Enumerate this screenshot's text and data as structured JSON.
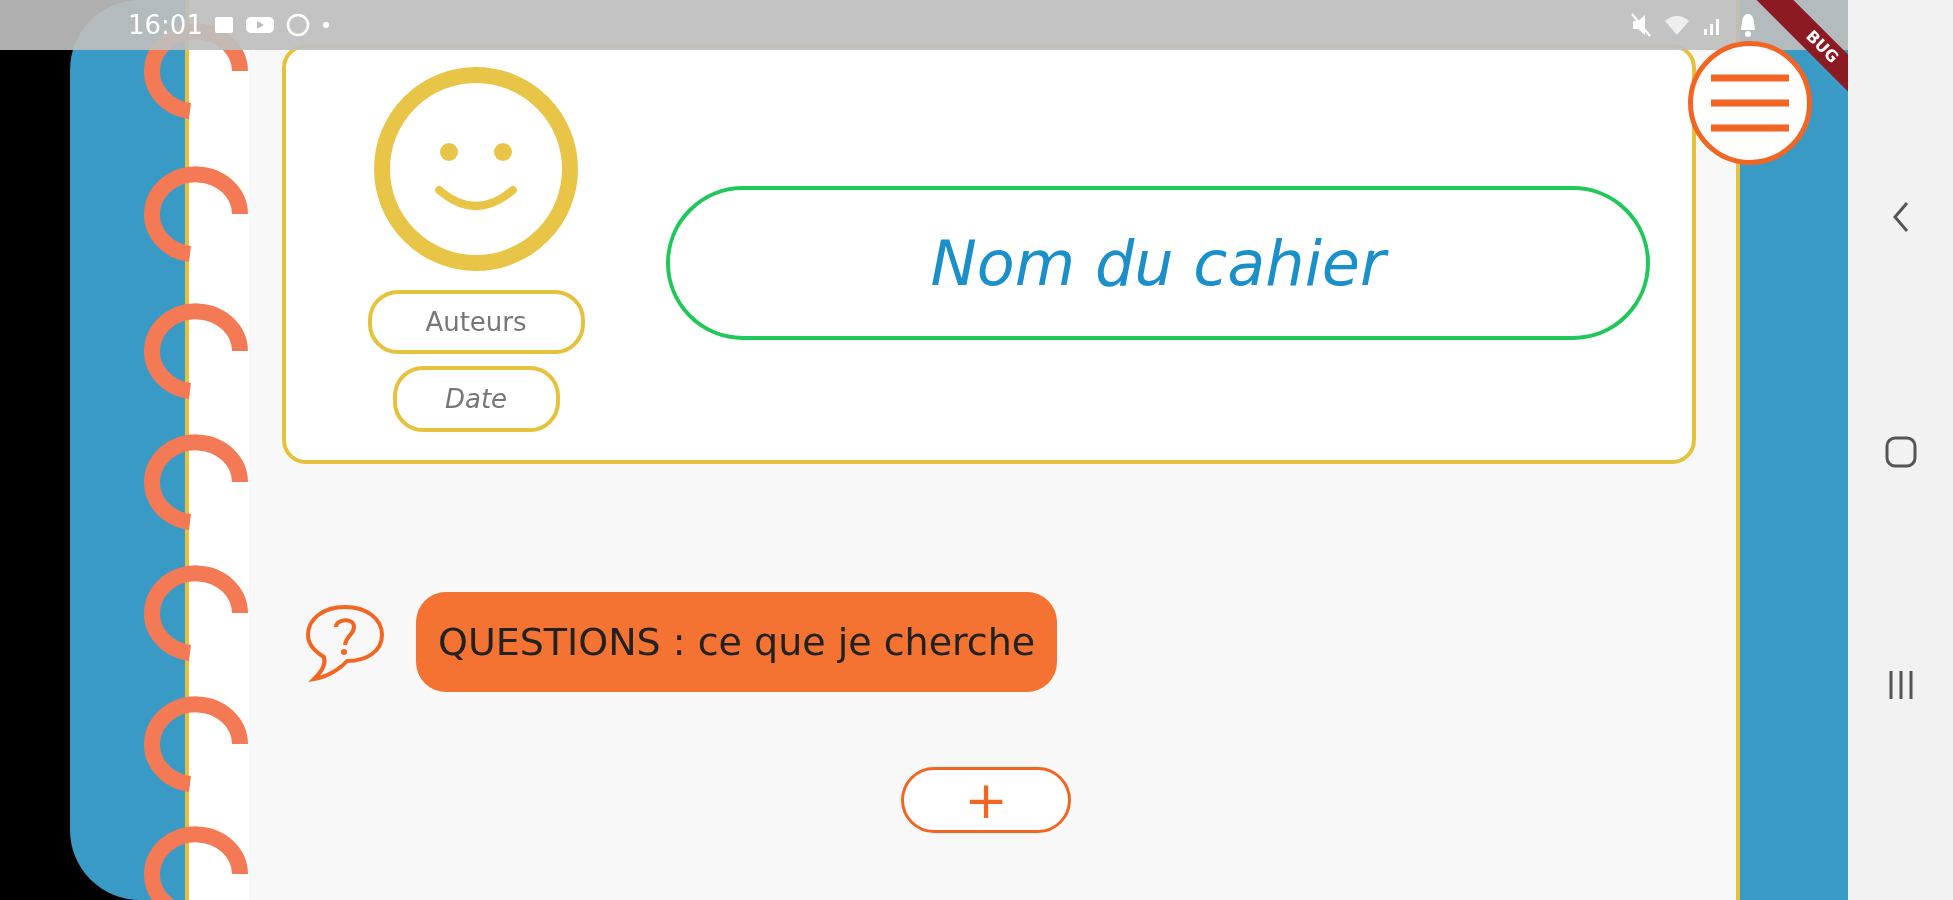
{
  "status_bar": {
    "time": "16:01"
  },
  "debug_banner": {
    "text": "BUG"
  },
  "header": {
    "authors": {
      "placeholder": "Auteurs"
    },
    "date": {
      "placeholder": "Date"
    },
    "notebook_name": {
      "placeholder": "Nom du cahier"
    }
  },
  "sections": [
    {
      "kind": "questions",
      "label": "QUESTIONS : ce que je cherche",
      "color": "#f47332"
    }
  ],
  "add_button": {
    "label": "+"
  }
}
